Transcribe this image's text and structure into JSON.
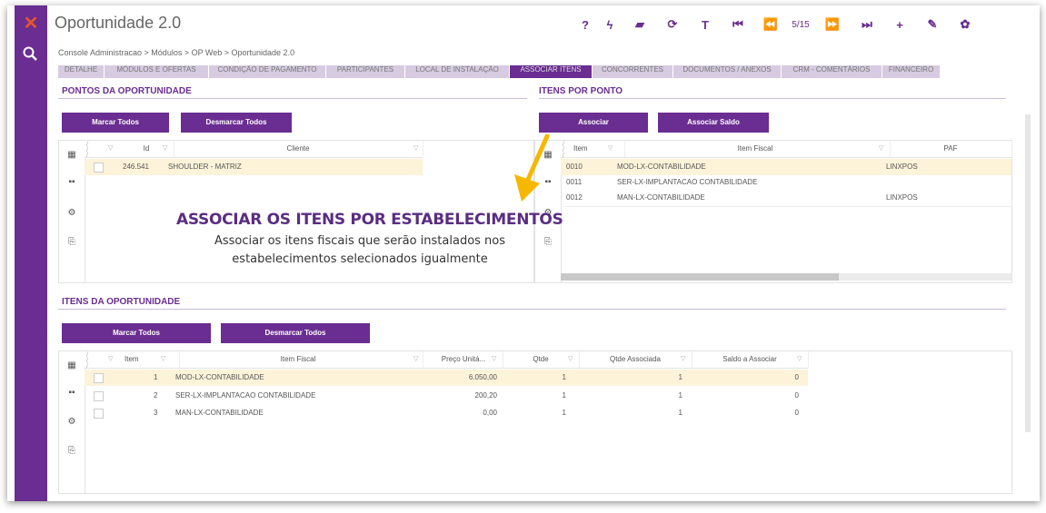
{
  "app": {
    "title": "Oportunidade 2.0",
    "counter": "5/15"
  },
  "toolbar": {
    "icons": [
      "help-icon",
      "flash-icon",
      "eraser-icon",
      "refresh-icon",
      "filter-icon",
      "first-icon",
      "prev-icon",
      "counter",
      "next-icon",
      "last-icon",
      "add-icon",
      "edit-icon",
      "settings-icon",
      "menu-icon"
    ],
    "glyphs": [
      "?",
      "ϟ",
      "▰",
      "⟳",
      "T",
      "⏮",
      "⏪",
      "",
      "⏩",
      "⏭",
      "+",
      "✎",
      "✿",
      "≡"
    ]
  },
  "breadcrumb": "Console Administracao  >  Módulos  >  OP Web  >  Oportunidade 2.0",
  "tabs": [
    "DETALHE",
    "MÓDULOS E OFERTAS",
    "CONDIÇÃO DE PAGAMENTO",
    "PARTICIPANTES",
    "LOCAL DE INSTALAÇÃO",
    "ASSOCIAR ITENS",
    "CONCORRENTES",
    "DOCUMENTOS / ANEXOS",
    "CRM - COMENTÁRIOS",
    "FINANCEIRO"
  ],
  "pontos": {
    "title": "PONTOS DA OPORTUNIDADE",
    "marcar": "Marcar Todos",
    "desmarcar": "Desmarcar Todos",
    "columns": {
      "id": "Id",
      "cliente": "Cliente"
    },
    "rows": [
      {
        "id": "246.541",
        "cliente": "SHOULDER - MATRIZ"
      }
    ]
  },
  "itens_ponto": {
    "title": "ITENS POR PONTO",
    "associar": "Associar",
    "associar_saldo": "Associar Saldo",
    "columns": {
      "item": "Item",
      "item_fiscal": "Item Fiscal",
      "paf": "PAF"
    },
    "rows": [
      {
        "item": "0010",
        "item_fiscal": "MOD-LX-CONTABILIDADE",
        "paf": "LINXPOS"
      },
      {
        "item": "0011",
        "item_fiscal": "SER-LX-IMPLANTACAO CONTABILIDADE",
        "paf": ""
      },
      {
        "item": "0012",
        "item_fiscal": "MAN-LX-CONTABILIDADE",
        "paf": "LINXPOS"
      }
    ]
  },
  "callout": {
    "title": "ASSOCIAR OS ITENS POR ESTABELECIMENTOS",
    "line1": "Associar os itens fiscais que serão instalados nos",
    "line2": "estabelecimentos selecionados igualmente",
    "arrow_color": "#f5b700"
  },
  "itens_oportunidade": {
    "title": "ITENS DA OPORTUNIDADE",
    "marcar": "Marcar Todos",
    "desmarcar": "Desmarcar Todos",
    "columns": {
      "item": "Item",
      "item_fiscal": "Item Fiscal",
      "preco": "Preço Unitá...",
      "qtde": "Qtde",
      "qtde_assoc": "Qtde Associada",
      "saldo": "Saldo a Associar"
    },
    "rows": [
      {
        "item": "1",
        "item_fiscal": "MOD-LX-CONTABILIDADE",
        "preco": "6.050,00",
        "qtde": "1",
        "qtde_assoc": "1",
        "saldo": "0"
      },
      {
        "item": "2",
        "item_fiscal": "SER-LX-IMPLANTACAO CONTABILIDADE",
        "preco": "200,20",
        "qtde": "1",
        "qtde_assoc": "1",
        "saldo": "0"
      },
      {
        "item": "3",
        "item_fiscal": "MAN-LX-CONTABILIDADE",
        "preco": "0,00",
        "qtde": "1",
        "qtde_assoc": "1",
        "saldo": "0"
      }
    ]
  },
  "colors": {
    "brand": "#6a2d91",
    "highlight": "#fdf3d9",
    "logo": "#e8542a"
  }
}
